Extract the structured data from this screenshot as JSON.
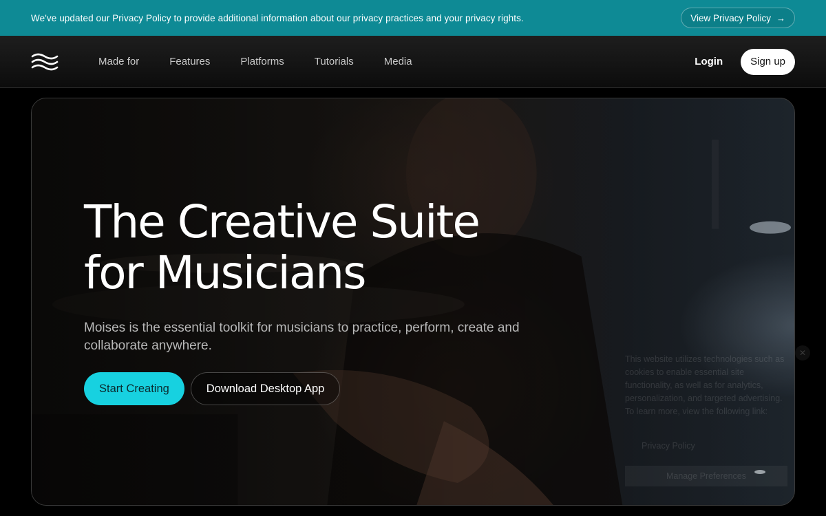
{
  "banner": {
    "text": "We've updated our Privacy Policy to provide additional information about our privacy practices and your privacy rights.",
    "button_label": "View Privacy Policy",
    "button_arrow": "→"
  },
  "nav": {
    "links": [
      "Made for",
      "Features",
      "Platforms",
      "Tutorials",
      "Media"
    ],
    "login_label": "Login",
    "signup_label": "Sign up"
  },
  "hero": {
    "title_line1": "The Creative Suite",
    "title_line2": "for Musicians",
    "subtitle": "Moises is the essential toolkit for musicians to practice, perform, create and collaborate anywhere.",
    "primary_button": "Start Creating",
    "secondary_button": "Download Desktop App"
  },
  "cookie_notice": {
    "text": "This website utilizes technologies such as cookies to enable essential site functionality, as well as for analytics, personalization, and targeted advertising. To learn more, view the following link:",
    "link_label": "Privacy Policy",
    "button_label": "Manage Preferences",
    "close_glyph": "✕"
  },
  "colors": {
    "banner_bg": "#0e8a95",
    "accent": "#17d1e0",
    "nav_bg": "#141414"
  },
  "icons": {
    "logo": "moises-wave-logo",
    "banner_arrow": "arrow-right-icon"
  }
}
